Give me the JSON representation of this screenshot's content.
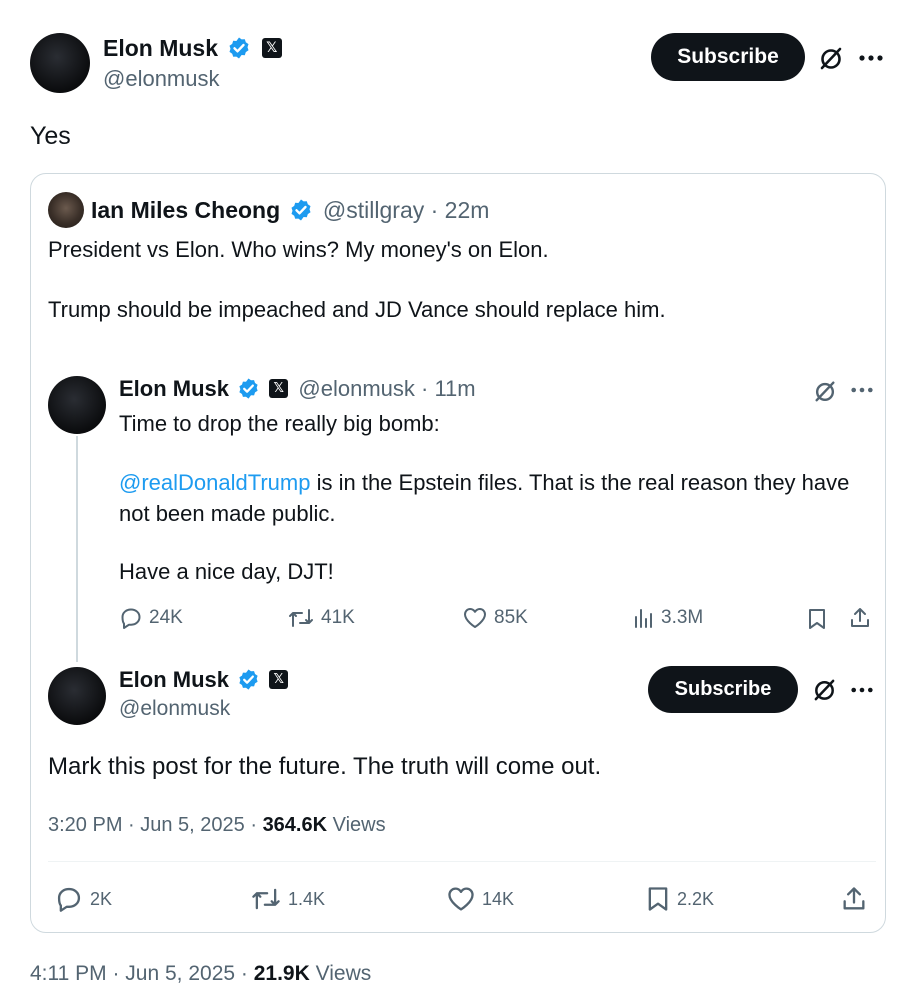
{
  "main_post": {
    "author_name": "Elon Musk",
    "handle": "@elonmusk",
    "subscribe_label": "Subscribe",
    "text": "Yes",
    "time": "4:11 PM · Jun 5, 2025 · ",
    "views_count": "21.9K",
    "views_label": " Views"
  },
  "quote": {
    "author_name": "Ian Miles Cheong",
    "handle": "@stillgray",
    "age": " · 22m",
    "line1": "President vs Elon. Who wins? My money's on Elon.",
    "line2": "Trump should be impeached and JD Vance should replace him."
  },
  "nested_post": {
    "author_name": "Elon Musk",
    "handle": "@elonmusk",
    "age": " · 11m",
    "line1": "Time to drop the really big bomb:",
    "mention": "@realDonaldTrump",
    "line2_rest": " is in the Epstein files. That is the real reason they have",
    "line3": "not been made public.",
    "line4": "Have a nice day, DJT!",
    "stats": {
      "replies": "24K",
      "reposts": "41K",
      "likes": "85K",
      "views": "3.3M"
    }
  },
  "reply_post": {
    "author_name": "Elon Musk",
    "handle": "@elonmusk",
    "subscribe_label": "Subscribe",
    "text": "Mark this post for the future. The truth will come out.",
    "time": "3:20 PM · Jun 5, 2025 · ",
    "views_count": "364.6K",
    "views_label": " Views",
    "stats": {
      "replies": "2K",
      "reposts": "1.4K",
      "likes": "14K",
      "bookmarks": "2.2K"
    }
  },
  "badges": {
    "x_glyph": "𝕏"
  },
  "colors": {
    "verified": "#1d9bf0",
    "mention": "#1d9bf0",
    "muted": "#536471",
    "border": "#cfd9de"
  }
}
